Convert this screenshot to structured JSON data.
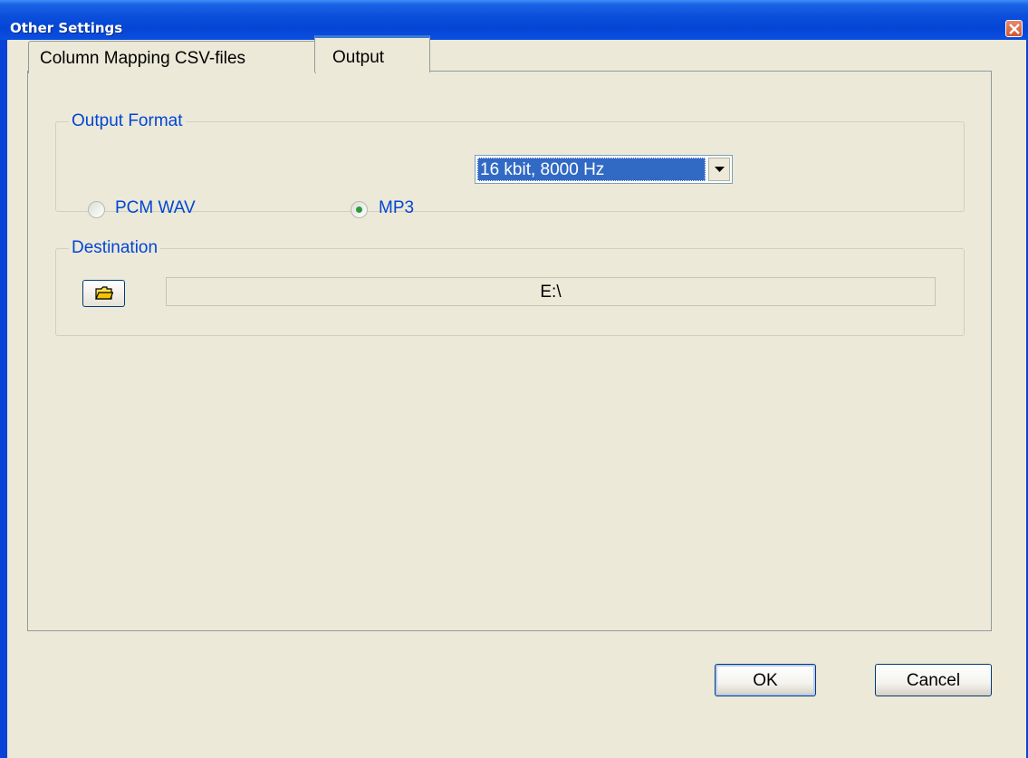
{
  "window": {
    "title": "Other Settings",
    "close_icon": "close-icon",
    "titlebar_color": "#0a4fdb",
    "face_color": "#ece9d8"
  },
  "tabs": [
    {
      "label": "Column Mapping CSV-files",
      "selected": false
    },
    {
      "label": "Output",
      "selected": true
    }
  ],
  "output_format": {
    "legend": "Output Format",
    "options": [
      {
        "label": "PCM WAV",
        "checked": false
      },
      {
        "label": "MP3",
        "checked": true
      }
    ],
    "mp3_quality": {
      "selected": "16 kbit, 8000 Hz"
    }
  },
  "destination": {
    "legend": "Destination",
    "browse_icon": "folder-icon",
    "path": "E:\\"
  },
  "buttons": {
    "ok": "OK",
    "cancel": "Cancel"
  },
  "colors": {
    "legend_text": "#0046d5",
    "selection": "#316ac5"
  }
}
